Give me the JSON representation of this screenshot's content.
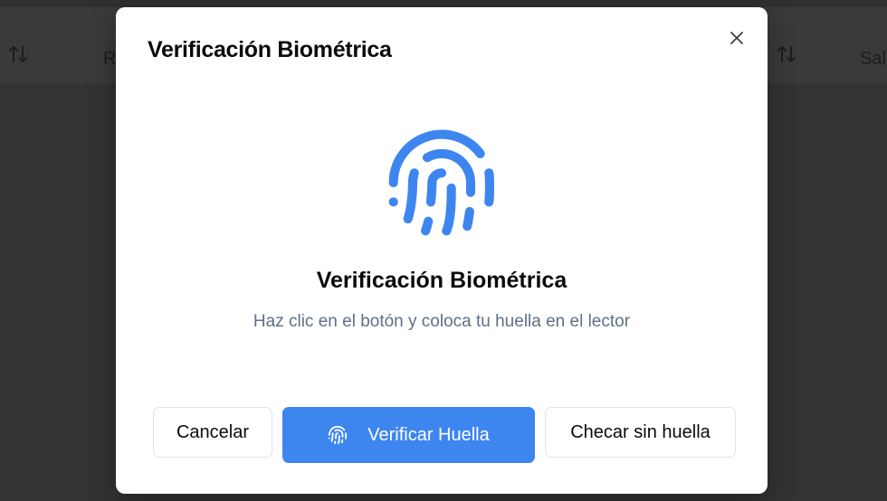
{
  "background": {
    "columns": [
      {
        "label": "R"
      },
      {
        "label": "Sal"
      }
    ]
  },
  "modal": {
    "title": "Verificación Biométrica",
    "heading": "Verificación Biométrica",
    "subtitle": "Haz clic en el botón y coloca tu huella en el lector",
    "icon": "fingerprint-icon",
    "accent_color": "#3d86f0",
    "buttons": {
      "cancel_label": "Cancelar",
      "verify_label": "Verificar Huella",
      "no_fingerprint_label": "Checar sin huella"
    }
  }
}
